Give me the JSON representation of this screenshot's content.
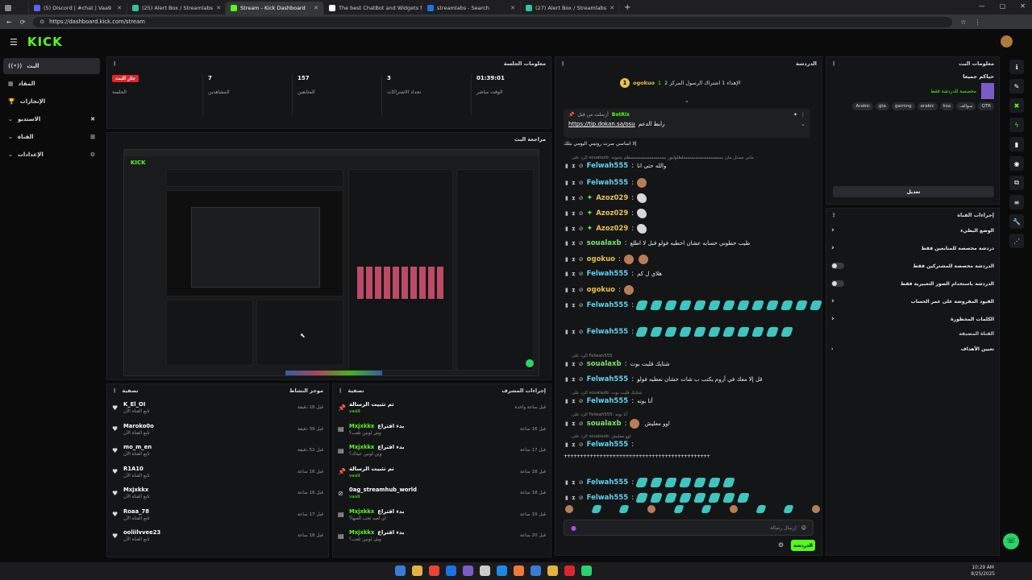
{
  "browser": {
    "tabs": [
      {
        "label": "(5) Discord | #chat | Vaa9",
        "color": "#5865f2"
      },
      {
        "label": "(25) Alert Box / Streamlabs",
        "color": "#31c3a2"
      },
      {
        "label": "Stream - Kick Dashboard",
        "color": "#53fc18"
      },
      {
        "label": "The best ChatBot and Widgets fo",
        "color": "#ffffff"
      },
      {
        "label": "streamlabs - Search",
        "color": "#1a73e8"
      },
      {
        "label": "(27) Alert Box / Streamlabs",
        "color": "#31c3a2"
      }
    ],
    "url": "https://dashboard.kick.com/stream"
  },
  "brand": {
    "logo": "KICK",
    "accent": "#53fc18"
  },
  "sidebar": {
    "items": [
      {
        "label": "البث",
        "icon": "broadcast-icon"
      },
      {
        "label": "المقاد",
        "icon": "grid-icon"
      },
      {
        "label": "الإنجازات",
        "icon": "trophy-icon"
      },
      {
        "label": "الاستديو",
        "icon": "studio-icon"
      },
      {
        "label": "القناة",
        "icon": "channel-icon"
      },
      {
        "label": "الإعدادات",
        "icon": "gear-icon"
      }
    ]
  },
  "session": {
    "title": "معلومات الجلسة",
    "live_badge": "جار البث",
    "live_sub": "الجلسة",
    "stats": [
      {
        "value": "7",
        "label": "المشاهدين"
      },
      {
        "value": "157",
        "label": "المتابعين"
      },
      {
        "value": "3",
        "label": "تحداد الاشتراكات"
      },
      {
        "value": "01:39:01",
        "label": "الوقت مباشر"
      }
    ]
  },
  "preview": {
    "title": "مراجعة البث"
  },
  "activity": {
    "title": "موجز النشاط",
    "filter": "تصفية",
    "rows": [
      {
        "name": "K_El_OI",
        "sub": "تابع القناة الآن",
        "time": "قبل 18 دقيقة"
      },
      {
        "name": "Maroko0o",
        "sub": "تابع القناة الآن",
        "time": "قبل 39 دقيقة"
      },
      {
        "name": "mo_m_en",
        "sub": "تابع القناة الآن",
        "time": "قبل 52 دقيقة"
      },
      {
        "name": "R1A10",
        "sub": "تابع القناة الآن",
        "time": "قبل 16 ساعة"
      },
      {
        "name": "Mxjxkkx",
        "sub": "تابع القناة الآن",
        "time": "قبل 16 ساعة"
      },
      {
        "name": "Roaa_78",
        "sub": "تابع القناة الآن",
        "time": "قبل 17 ساعة"
      },
      {
        "name": "ooliilvvee23",
        "sub": "تابع القناة الآن",
        "time": "قبل 18 ساعة"
      }
    ]
  },
  "moderation": {
    "title": "إجراءات المشرف",
    "filter": "تصفية",
    "rows": [
      {
        "action": "تم تثبيت الرسالة",
        "user": "vaa9",
        "time": "قبل ساعة واحدة"
      },
      {
        "action": "بدء اقتراع",
        "user": "Mxjxkkx",
        "sub": "وش لونين تلعب؟",
        "time": "قبل 16 ساعة"
      },
      {
        "action": "بدء اقتراع",
        "user": "Mxjxkkx",
        "sub": "وين لونين عيناك؟",
        "time": "قبل 17 ساعة"
      },
      {
        "action": "تم تثبيت الرسالة",
        "user": "vaa9",
        "time": "قبل 18 ساعة"
      },
      {
        "action": "0ag_streamhub_world",
        "user": "vaa9",
        "time": "قبل 18 ساعة"
      },
      {
        "action": "بدء اقتراع",
        "user": "Mxjxkkx",
        "sub": "اي لعبه تحب العبها؟",
        "time": "قبل 19 ساعة"
      },
      {
        "action": "بدء اقتراع",
        "user": "Mxjxkkx",
        "sub": "وش لونين تلعب؟",
        "time": "قبل 20 ساعة"
      }
    ]
  },
  "chat": {
    "title": "الدردشة",
    "top_user": "ogokuo",
    "top_count": "1",
    "top_text": "الإهداء 1 اشتراك الرسول المركز 2",
    "pinned_by": "BotRix",
    "pinned_label": "أرسلت من قبل",
    "pinned_text": "رابط الدعم",
    "pinned_link": "https://tip.dokan.sa/osu",
    "messages": [
      {
        "user": "",
        "text": "إلا اساسي صرت روتيني اليومي بتلك"
      },
      {
        "user": "Felwah555",
        "text": "والله حتى انا",
        "reply": "الرد على soualaxb: ماني مستل مان يسسسسسسسسسسلطلولبور بسسسسسسسسسطم يحبوته"
      },
      {
        "user": "Felwah555",
        "text": ""
      },
      {
        "user": "Azoz029",
        "text": ""
      },
      {
        "user": "Azoz029",
        "text": ""
      },
      {
        "user": "Azoz029",
        "text": ""
      },
      {
        "user": "soualaxb",
        "text": "طيب حطوني حسابه عشان احطيه فولو قبل لا اطلع"
      },
      {
        "user": "ogokuo",
        "text": ""
      },
      {
        "user": "Felwah555",
        "text": "هلاي ل كم"
      },
      {
        "user": "ogokuo",
        "text": ""
      },
      {
        "user": "Felwah555",
        "text": ""
      },
      {
        "user": "Felwah555",
        "text": ""
      },
      {
        "user": "soualaxb",
        "text": "شتايك قليت بوت",
        "reply": "الرد على Felwah555"
      },
      {
        "user": "Felwah555",
        "text": "قل إلا معك في أروم يكتب ب شات حشان نعطيه فولو"
      },
      {
        "user": "Felwah555",
        "text": "أنا بوته",
        "reply": "الرد على soualaxb: شتايك قليت بوت"
      },
      {
        "user": "soualaxb",
        "text": "اوو معليش",
        "reply": "الرد على Felwah555: أنا بوته"
      },
      {
        "user": "Felwah555",
        "text": "",
        "reply": "الرد على soualaxb: اوو معليش"
      },
      {
        "user": "",
        "text": "+++++++++++++++++++++++++++++++++++++++++++++"
      },
      {
        "user": "Felwah555",
        "text": ""
      },
      {
        "user": "Felwah555",
        "text": ""
      }
    ],
    "input_placeholder": "إرسال رسالة",
    "send": "الدردشة"
  },
  "stream_info": {
    "title": "معلومات البث",
    "stream_title": "حياكم جميعا",
    "category": "مخصصة للدردشة فقط",
    "tags": [
      "Arabic",
      "gta",
      "gaming",
      "arabic",
      "ksa",
      "سوالف",
      "QTR"
    ],
    "edit": "تعديل"
  },
  "channel_actions": {
    "title": "إجراءات القناة",
    "items": [
      {
        "label": "الوضع البطيء",
        "kind": "arrow"
      },
      {
        "label": "دردشة مخصصة للمتابعين فقط",
        "kind": "arrow"
      },
      {
        "label": "الدردشة مخصصة للمشتركين فقط",
        "kind": "toggle"
      },
      {
        "label": "الدردشة باستخدام الصور التعبيرية فقط",
        "kind": "toggle"
      },
      {
        "label": "القيود المفروضة على عمر الحساب",
        "kind": "arrow"
      },
      {
        "label": "الكلمات المحظورة",
        "kind": "arrow"
      }
    ],
    "section2": "القناة المضيفة",
    "host": "تعيين الأهداف"
  },
  "taskbar": {
    "time": "10:29 AM",
    "date": "8/25/2025"
  }
}
